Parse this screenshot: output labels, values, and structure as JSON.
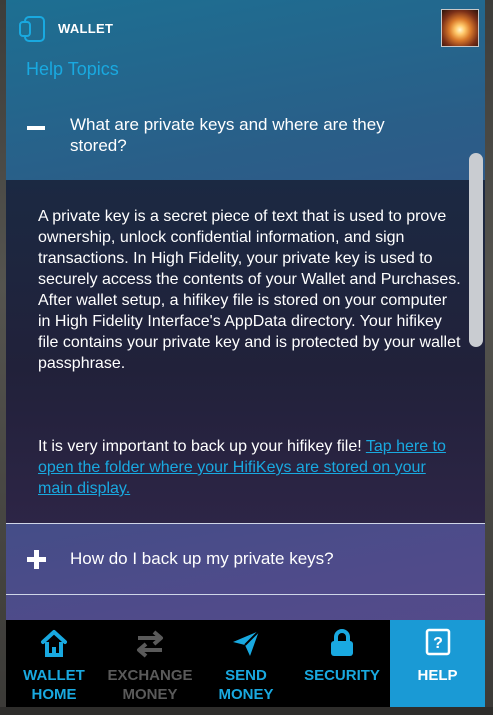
{
  "header": {
    "title": "WALLET",
    "icon": "wallet-icon",
    "avatar": "user-avatar"
  },
  "help_topics_label": "Help Topics",
  "faq": {
    "q1": {
      "question": "What are private keys and where are they stored?",
      "expanded": true,
      "toggle_icon": "minus-icon",
      "answer_p1": "A private key is a secret piece of text that is used to prove ownership, unlock confidential information, and sign transactions. In High Fidelity, your private key is used to securely access the contents of your Wallet and Purchases. After wallet setup, a hifikey file is stored on your computer in High Fidelity Interface's AppData directory. Your hifikey file contains your private key and is protected by your wallet passphrase.",
      "answer_p2_text": "It is very important to back up your hifikey file! ",
      "answer_p2_link": "Tap here to open the folder where your HifiKeys are stored on your main display."
    },
    "q2": {
      "question": "How do I back up my private keys?",
      "expanded": false,
      "toggle_icon": "plus-icon"
    }
  },
  "tabs": [
    {
      "label_1": "WALLET",
      "label_2": "HOME",
      "icon": "home-icon",
      "color": "#19a9e0",
      "enabled": true
    },
    {
      "label_1": "EXCHANGE",
      "label_2": "MONEY",
      "icon": "exchange-arrows-icon",
      "color": "#5a5a5a",
      "enabled": false
    },
    {
      "label_1": "SEND",
      "label_2": "MONEY",
      "icon": "send-paper-plane-icon",
      "color": "#19a9e0",
      "enabled": true
    },
    {
      "label_1": "SECURITY",
      "label_2": "",
      "icon": "lock-icon",
      "color": "#19a9e0",
      "enabled": true
    },
    {
      "label_1": "HELP",
      "label_2": "",
      "icon": "help-question-icon",
      "color": "#ffffff",
      "active": true
    }
  ],
  "colors": {
    "accent": "#19a9e0",
    "active_tab_bg": "#1a9ad5",
    "disabled": "#5a5a5a",
    "tabbar_bg": "#000000"
  }
}
